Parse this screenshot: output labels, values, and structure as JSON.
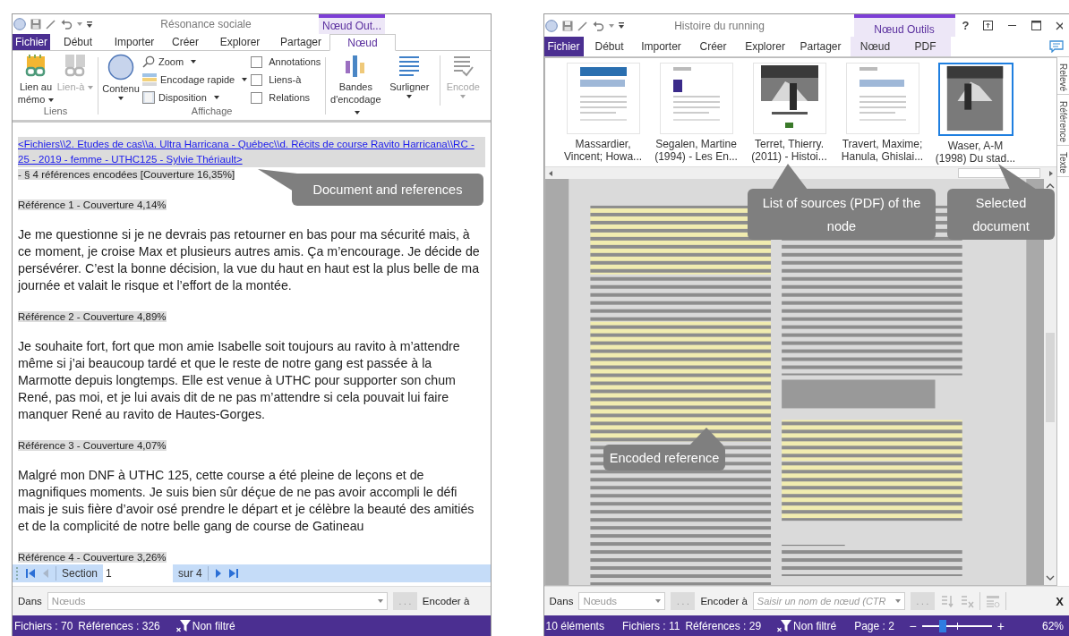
{
  "left_window": {
    "title": "Résonance sociale",
    "context_tab": "Nœud Out...",
    "tabs": [
      {
        "label": "Fichier",
        "kind": "file",
        "selected": false
      },
      {
        "label": "Début",
        "kind": "tab",
        "selected": false
      },
      {
        "label": "Importer",
        "kind": "tab",
        "selected": false
      },
      {
        "label": "Créer",
        "kind": "tab",
        "selected": false
      },
      {
        "label": "Explorer",
        "kind": "tab",
        "selected": false
      },
      {
        "label": "Partager",
        "kind": "tab",
        "selected": false
      },
      {
        "label": "Nœud",
        "kind": "context",
        "selected": true
      }
    ],
    "ribbon": {
      "liens": {
        "label": "Liens",
        "buttons": [
          {
            "label": "Lien au mémo",
            "disabled": false
          },
          {
            "label": "Lien-à",
            "disabled": true
          }
        ]
      },
      "affichage": {
        "label": "Affichage",
        "content_button": "Contenu",
        "menu_items": [
          "Zoom",
          "Encodage rapide",
          "Disposition"
        ],
        "checkboxes": [
          {
            "label": "Annotations",
            "checked": false
          },
          {
            "label": "Liens-à",
            "checked": false
          },
          {
            "label": "Relations",
            "checked": false
          }
        ]
      },
      "buttons": [
        {
          "label": "Bandes d'encodage",
          "disabled": false
        },
        {
          "label": "Surligner",
          "disabled": false
        },
        {
          "label": "Encode",
          "disabled": true
        }
      ]
    },
    "document": {
      "link": "<Fichiers\\\\2. Etudes de cas\\\\a. Ultra Harricana - Québec\\\\d. Récits de course Ravito Harricana\\\\RC - 25 - 2019 - femme - UTHC125 - Sylvie Thériault>",
      "summary": "- § 4 références encodées  [Couverture 16,35%]",
      "references": [
        {
          "header": "Référence 1 - Couverture 4,14%",
          "text": "Je me questionne si je ne devrais pas retourner en bas pour ma sécurité mais, à ce moment, je croise Max et plusieurs autres amis. Ça m’encourage. Je décide de persévérer. C’est la bonne décision, la vue du haut en haut est la plus belle de ma journée et valait le risque et l’effort de la montée."
        },
        {
          "header": "Référence 2 - Couverture 4,89%",
          "text": "Je souhaite fort, fort que mon amie Isabelle soit toujours au ravito à m’attendre même si j’ai beaucoup tardé et que le reste de notre gang est passée à la Marmotte depuis longtemps. Elle est venue à UTHC pour supporter son chum René, pas moi, et je lui avais dit de ne pas m’attendre si cela pouvait lui faire manquer René au ravito de Hautes-Gorges."
        },
        {
          "header": "Référence 3 - Couverture 4,07%",
          "text": "Malgré mon DNF à UTHC 125, cette course a été pleine de leçons et de magnifiques moments. Je suis bien sûr déçue de ne pas avoir accompli le défi mais je suis fière d’avoir osé prendre le départ et je célèbre la beauté des amitiés et de la complicité de notre belle gang de course de Gatineau"
        },
        {
          "header": "Référence 4 - Couverture 3,26%"
        }
      ]
    },
    "navigator": {
      "label": "Section",
      "value": "1",
      "total": "sur 4"
    },
    "code_bar": {
      "label": "Dans",
      "placeholder": "Nœuds",
      "more": ". . .",
      "action": "Encoder à"
    },
    "status_bar": {
      "files": "Fichiers : 70",
      "references": "Références : 326",
      "filter": "Non filtré"
    }
  },
  "right_window": {
    "title": "Histoire du running",
    "context_tab": "Nœud Outils",
    "help": "?",
    "tabs": [
      {
        "label": "Fichier",
        "kind": "file",
        "selected": false
      },
      {
        "label": "Début",
        "kind": "tab",
        "selected": false
      },
      {
        "label": "Importer",
        "kind": "tab",
        "selected": false
      },
      {
        "label": "Créer",
        "kind": "tab",
        "selected": false
      },
      {
        "label": "Explorer",
        "kind": "tab",
        "selected": false
      },
      {
        "label": "Partager",
        "kind": "tab",
        "selected": false
      },
      {
        "label": "Nœud",
        "kind": "context",
        "selected": false
      },
      {
        "label": "PDF",
        "kind": "context",
        "selected": false
      }
    ],
    "sources": [
      {
        "lines": [
          "Massardier,",
          "Vincent; Howa..."
        ],
        "selected": false
      },
      {
        "lines": [
          "Segalen, Martine",
          "(1994) - Les En..."
        ],
        "selected": false
      },
      {
        "lines": [
          "Terret, Thierry.",
          "(2011) - Histoi..."
        ],
        "selected": false
      },
      {
        "lines": [
          "Travert, Maxime;",
          "Hanula, Ghislai..."
        ],
        "selected": false
      },
      {
        "lines": [
          "Waser, A-M",
          "(1998) Du stad..."
        ],
        "selected": true
      }
    ],
    "side_tabs": [
      "Relevé",
      "Référence",
      "Texte"
    ],
    "code_bar": {
      "label": "Dans",
      "placeholder": "Nœuds",
      "more": ". . .",
      "action": "Encoder à",
      "node_placeholder": "Saisir un nom de nœud (CTR",
      "more_2": ". . .",
      "close": "X"
    },
    "status_bar": {
      "items": "10 éléments",
      "files": "Fichiers : 11",
      "references": "Références : 29",
      "filter": "Non filtré",
      "page": "Page : 2",
      "minus": "−",
      "plus": "+",
      "zoom": {
        "level": 0.3
      },
      "percent": "62%"
    }
  },
  "callouts": [
    {
      "text": "Document and references"
    },
    {
      "text": "List of sources (PDF) of the node"
    },
    {
      "text": "Selected document"
    },
    {
      "text": "Encoded reference"
    }
  ]
}
